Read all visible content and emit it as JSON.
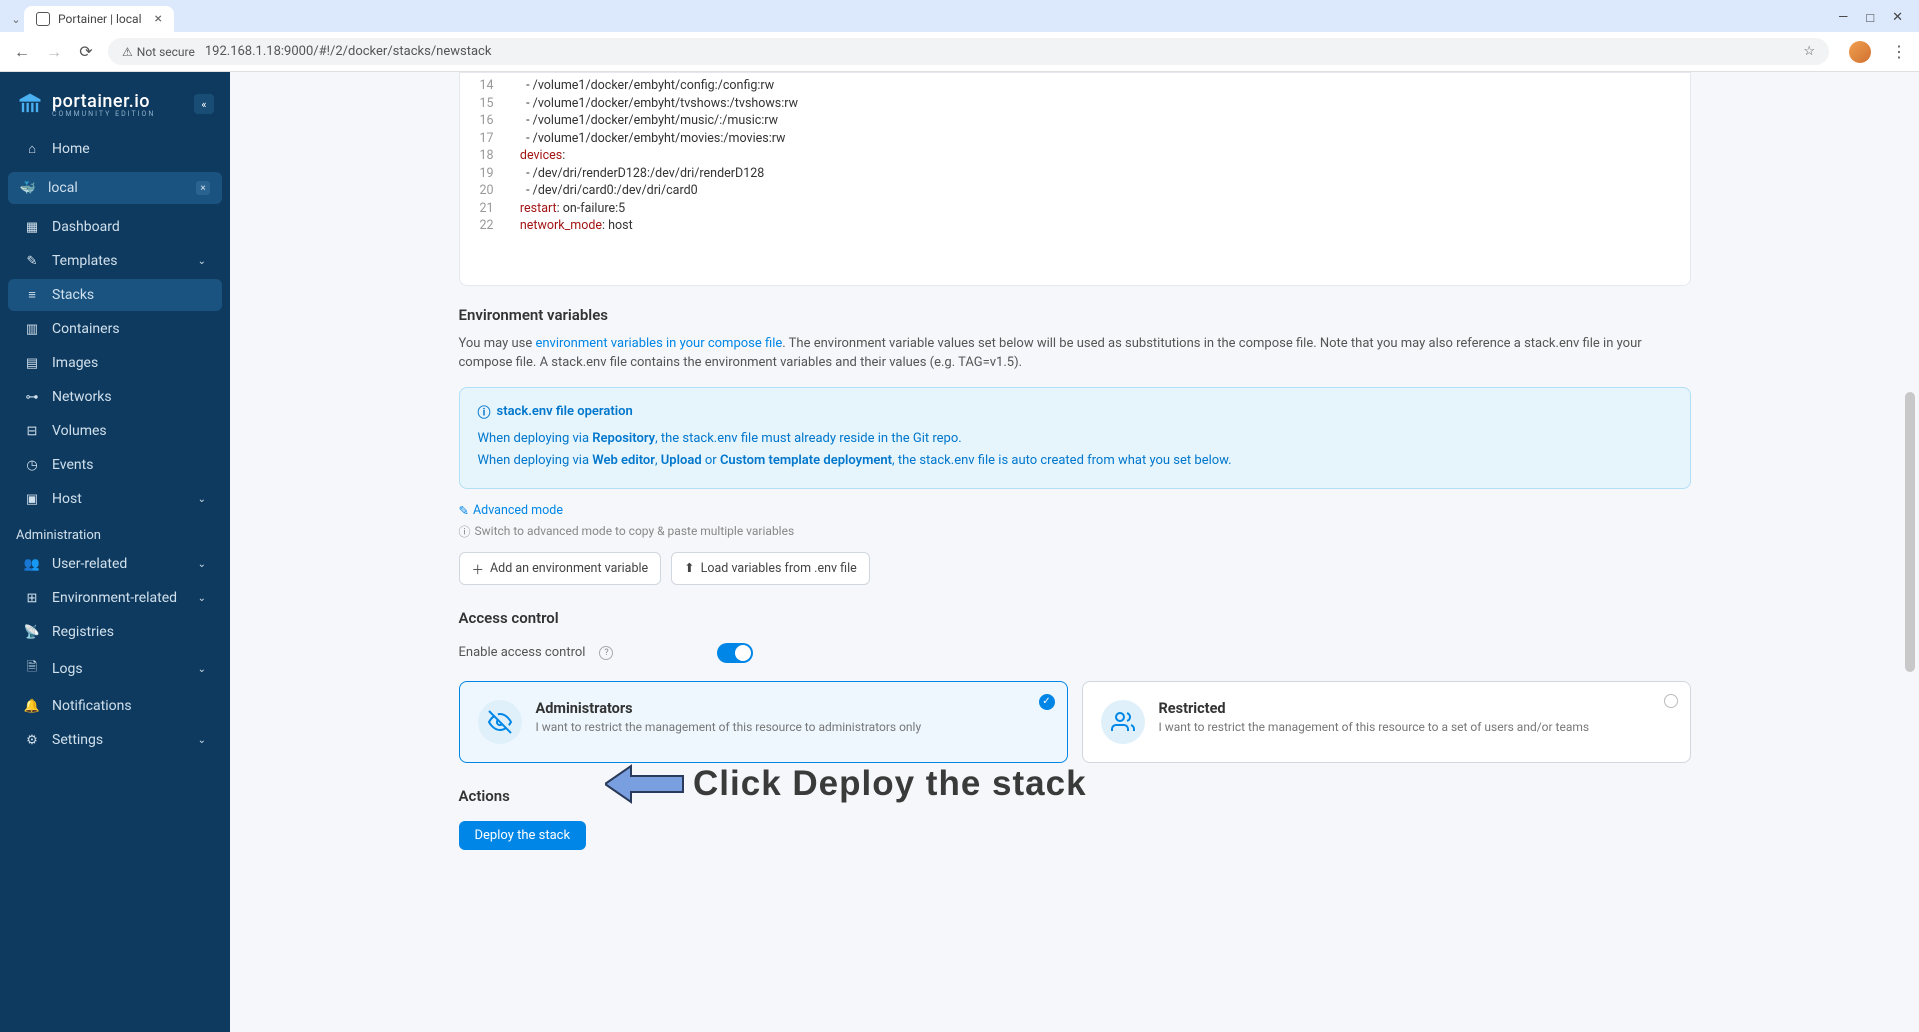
{
  "browser": {
    "tab_title": "Portainer | local",
    "not_secure_label": "Not secure",
    "url": "192.168.1.18:9000/#!/2/docker/stacks/newstack"
  },
  "sidebar": {
    "logo_main": "portainer.io",
    "logo_sub": "COMMUNITY EDITION",
    "home": "Home",
    "env_name": "local",
    "items": {
      "dashboard": "Dashboard",
      "templates": "Templates",
      "stacks": "Stacks",
      "containers": "Containers",
      "images": "Images",
      "networks": "Networks",
      "volumes": "Volumes",
      "events": "Events",
      "host": "Host"
    },
    "admin_header": "Administration",
    "admin": {
      "user_related": "User-related",
      "env_related": "Environment-related",
      "registries": "Registries",
      "logs": "Logs",
      "notifications": "Notifications",
      "settings": "Settings"
    }
  },
  "code": {
    "lines": [
      {
        "n": 14,
        "text": "      - /volume1/docker/embyht/config:/config:rw"
      },
      {
        "n": 15,
        "text": "      - /volume1/docker/embyht/tvshows:/tvshows:rw"
      },
      {
        "n": 16,
        "text": "      - /volume1/docker/embyht/music/:/music:rw"
      },
      {
        "n": 17,
        "text": "      - /volume1/docker/embyht/movies:/movies:rw"
      },
      {
        "n": 18,
        "key": "    devices",
        "val": ":"
      },
      {
        "n": 19,
        "text": "      - /dev/dri/renderD128:/dev/dri/renderD128"
      },
      {
        "n": 20,
        "text": "      - /dev/dri/card0:/dev/dri/card0"
      },
      {
        "n": 21,
        "key": "    restart",
        "val": ": on-failure:5"
      },
      {
        "n": 22,
        "key": "    network_mode",
        "val": ": host"
      }
    ]
  },
  "env": {
    "title": "Environment variables",
    "help_pre": "You may use ",
    "help_link": "environment variables in your compose file",
    "help_post": ". The environment variable values set below will be used as substitutions in the compose file. Note that you may also reference a stack.env file in your compose file. A stack.env file contains the environment variables and their values (e.g. TAG=v1.5).",
    "card_title": "stack.env file operation",
    "card_line1_pre": "When deploying via ",
    "card_line1_b1": "Repository",
    "card_line1_post": ", the stack.env file must already reside in the Git repo.",
    "card_line2_pre": "When deploying via ",
    "card_line2_b1": "Web editor",
    "card_line2_sep1": ", ",
    "card_line2_b2": "Upload",
    "card_line2_sep2": " or ",
    "card_line2_b3": "Custom template deployment",
    "card_line2_post": ", the stack.env file is auto created from what you set below.",
    "advanced_link": "Advanced mode",
    "advanced_hint": "Switch to advanced mode to copy & paste multiple variables",
    "add_btn": "Add an environment variable",
    "load_btn": "Load variables from .env file"
  },
  "access": {
    "title": "Access control",
    "toggle_label": "Enable access control",
    "admin_title": "Administrators",
    "admin_desc": "I want to restrict the management of this resource to administrators only",
    "restricted_title": "Restricted",
    "restricted_desc": "I want to restrict the management of this resource to a set of users and/or teams"
  },
  "actions": {
    "title": "Actions",
    "deploy_btn": "Deploy the stack"
  },
  "annotation": "Click Deploy the stack"
}
